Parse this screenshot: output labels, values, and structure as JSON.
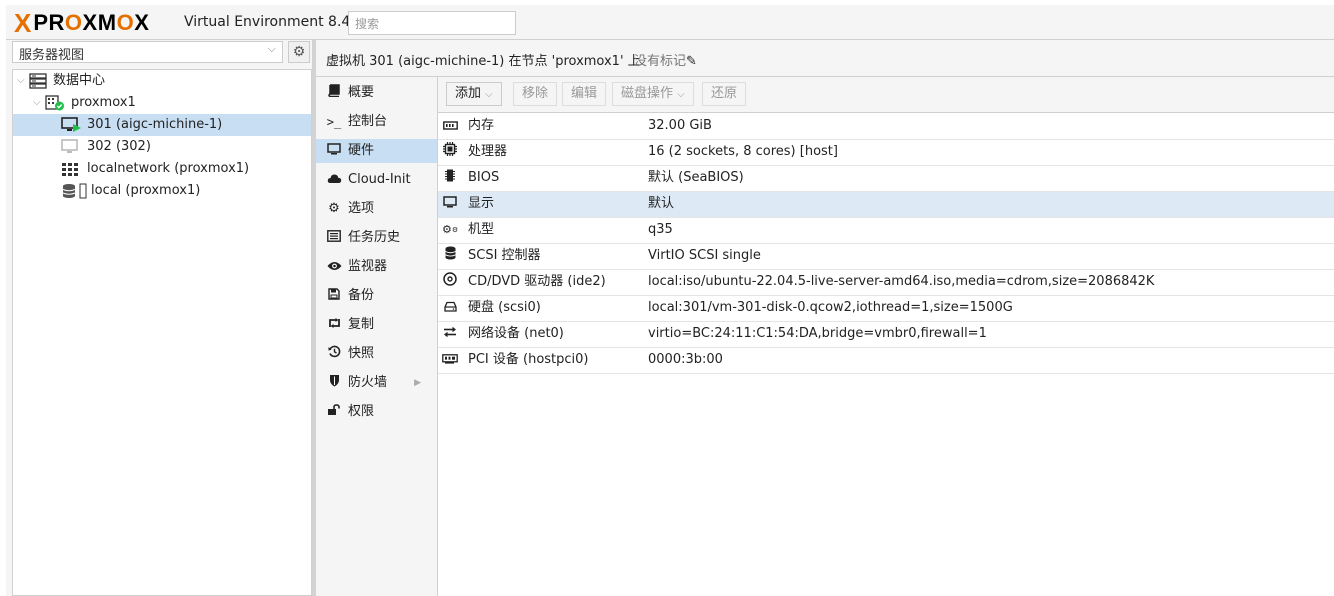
{
  "app": {
    "brand": "PROXMOX",
    "version": "Virtual Environment 8.4.0",
    "search_placeholder": "搜索"
  },
  "sidebar": {
    "view_select": "服务器视图",
    "tree": [
      {
        "label": "数据中心",
        "icon": "datacenter-icon"
      },
      {
        "label": "proxmox1",
        "icon": "node-online-icon"
      },
      {
        "label": "301 (aigc-michine-1)",
        "icon": "vm-running-icon",
        "selected": true
      },
      {
        "label": "302 (302)",
        "icon": "vm-stopped-icon"
      },
      {
        "label": "localnetwork (proxmox1)",
        "icon": "sdn-grid-icon"
      },
      {
        "label": "local (proxmox1)",
        "icon": "storage-icon"
      }
    ]
  },
  "header": {
    "title": "虚拟机 301 (aigc-michine-1) 在节点 'proxmox1' 上",
    "tags": "没有标记"
  },
  "subnav": {
    "items": [
      {
        "label": "概要",
        "icon": "summary-book-icon"
      },
      {
        "label": "控制台",
        "icon": "console-prompt-icon"
      },
      {
        "label": "硬件",
        "icon": "monitor-icon",
        "selected": true
      },
      {
        "label": "Cloud-Init",
        "icon": "cloud-icon"
      },
      {
        "label": "选项",
        "icon": "gear-icon"
      },
      {
        "label": "任务历史",
        "icon": "list-icon"
      },
      {
        "label": "监视器",
        "icon": "eye-icon"
      },
      {
        "label": "备份",
        "icon": "floppy-icon"
      },
      {
        "label": "复制",
        "icon": "retweet-icon"
      },
      {
        "label": "快照",
        "icon": "history-icon"
      },
      {
        "label": "防火墙",
        "icon": "shield-icon",
        "has_submenu": true
      },
      {
        "label": "权限",
        "icon": "unlock-icon"
      }
    ]
  },
  "toolbar": {
    "add": "添加",
    "remove": "移除",
    "edit": "编辑",
    "disk_action": "磁盘操作",
    "revert": "还原"
  },
  "hardware": {
    "rows": [
      {
        "key": "内存",
        "value": "32.00 GiB",
        "icon": "memory-icon"
      },
      {
        "key": "处理器",
        "value": "16 (2 sockets, 8 cores) [host]",
        "icon": "cpu-icon"
      },
      {
        "key": "BIOS",
        "value": "默认 (SeaBIOS)",
        "icon": "microchip-icon"
      },
      {
        "key": "显示",
        "value": "默认",
        "icon": "desktop-icon",
        "selected": true
      },
      {
        "key": "机型",
        "value": "q35",
        "icon": "cogs-icon"
      },
      {
        "key": "SCSI 控制器",
        "value": "VirtIO SCSI single",
        "icon": "database-icon"
      },
      {
        "key": "CD/DVD 驱动器 (ide2)",
        "value": "local:iso/ubuntu-22.04.5-live-server-amd64.iso,media=cdrom,size=2086842K",
        "icon": "cdrom-icon"
      },
      {
        "key": "硬盘 (scsi0)",
        "value": "local:301/vm-301-disk-0.qcow2,iothread=1,size=1500G",
        "icon": "harddisk-icon"
      },
      {
        "key": "网络设备 (net0)",
        "value": "virtio=BC:24:11:C1:54:DA,bridge=vmbr0,firewall=1",
        "icon": "exchange-icon"
      },
      {
        "key": "PCI 设备 (hostpci0)",
        "value": "0000:3b:00",
        "icon": "pci-card-icon"
      }
    ]
  },
  "colors": {
    "brand_orange": "#e57000",
    "selection": "#c8dff3",
    "running_green": "#21bf4b"
  }
}
